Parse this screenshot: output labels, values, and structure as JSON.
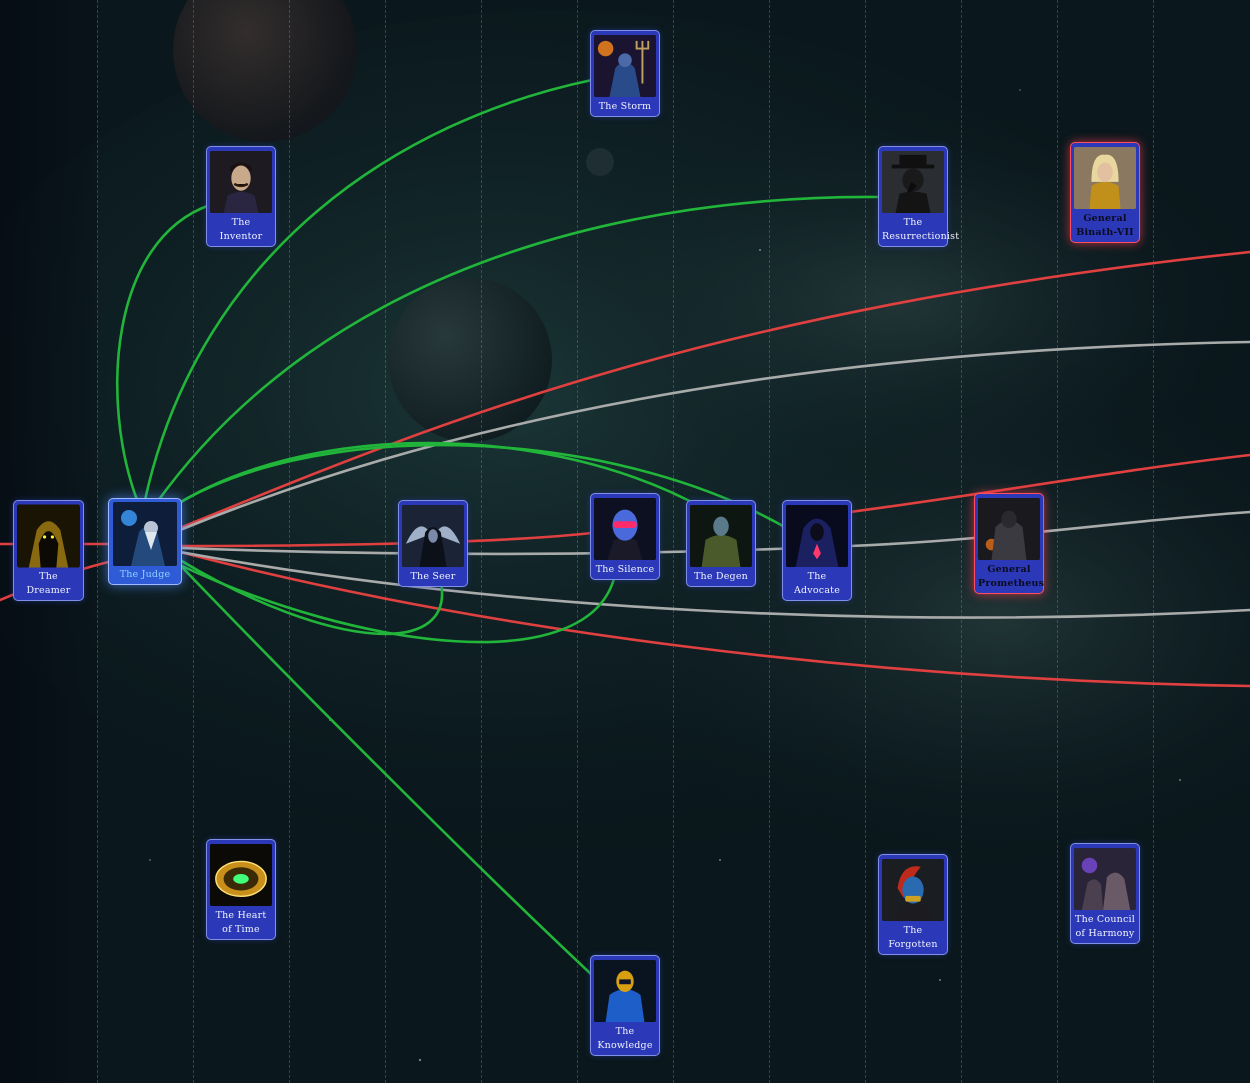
{
  "colors": {
    "background": "#0b1a1f",
    "node_fill": "#2b39b8",
    "node_border": "#7f90e6",
    "general_border": "#ff4f5e",
    "active_label": "#8fd4ff",
    "link_green": "#21b53a",
    "link_red": "#e0403f",
    "link_gray": "#a9abab"
  },
  "nodes": [
    {
      "id": "dreamer",
      "label": "The Dreamer",
      "icon": "hooded-figure-portrait",
      "kind": "normal"
    },
    {
      "id": "judge",
      "label": "The Judge",
      "icon": "wizard-portrait",
      "kind": "active"
    },
    {
      "id": "inventor",
      "label": "The Inventor",
      "icon": "mustached-man-portrait",
      "kind": "normal"
    },
    {
      "id": "heart",
      "label": "The Heart of Time",
      "icon": "clock-wheel-portrait",
      "kind": "normal"
    },
    {
      "id": "seer",
      "label": "The Seer",
      "icon": "winged-seer-portrait",
      "kind": "normal"
    },
    {
      "id": "storm",
      "label": "The Storm",
      "icon": "trident-warrior-portrait",
      "kind": "normal"
    },
    {
      "id": "silence",
      "label": "The Silence",
      "icon": "masked-alien-portrait",
      "kind": "normal"
    },
    {
      "id": "knowledge",
      "label": "The Knowledge",
      "icon": "blue-armored-portrait",
      "kind": "normal"
    },
    {
      "id": "degen",
      "label": "The Degen",
      "icon": "green-soldier-portrait",
      "kind": "normal"
    },
    {
      "id": "advocate",
      "label": "The Advocate",
      "icon": "hooded-mage-portrait",
      "kind": "normal"
    },
    {
      "id": "resurrectionist",
      "label": "The Resurrectionist",
      "icon": "plague-doctor-portrait",
      "kind": "normal"
    },
    {
      "id": "forgotten",
      "label": "The Forgotten",
      "icon": "red-haired-masked-portrait",
      "kind": "normal"
    },
    {
      "id": "prometheus",
      "label": "General Prometheus",
      "icon": "dark-knight-portrait",
      "kind": "general"
    },
    {
      "id": "binath",
      "label": "General Binath-VII",
      "icon": "blonde-warrior-portrait",
      "kind": "general"
    },
    {
      "id": "council",
      "label": "The Council of Harmony",
      "icon": "council-figures-portrait",
      "kind": "normal"
    }
  ],
  "links": [
    {
      "color": "green",
      "from": "judge",
      "to": "inventor"
    },
    {
      "color": "green",
      "from": "judge",
      "to": "storm"
    },
    {
      "color": "green",
      "from": "judge",
      "to": "resurrectionist"
    },
    {
      "color": "green",
      "from": "judge",
      "to": "degen"
    },
    {
      "color": "green",
      "from": "judge",
      "to": "advocate"
    },
    {
      "color": "green",
      "from": "judge",
      "to": "seer"
    },
    {
      "color": "green",
      "from": "judge",
      "to": "silence"
    },
    {
      "color": "green",
      "from": "judge",
      "to": "knowledge"
    },
    {
      "color": "red",
      "from": "dreamer",
      "to": "judge"
    },
    {
      "color": "red",
      "from": "judge",
      "to": "prometheus"
    },
    {
      "color": "red",
      "from": "judge",
      "to": "offscreen-top"
    },
    {
      "color": "red",
      "from": "judge",
      "to": "offscreen-bottom"
    },
    {
      "color": "red",
      "from": "offscreen-left",
      "to": "offscreen-right"
    },
    {
      "color": "gray",
      "from": "judge",
      "to": "advocate"
    },
    {
      "color": "gray",
      "from": "judge",
      "to": "offscreen-upper"
    },
    {
      "color": "gray",
      "from": "judge",
      "to": "offscreen-lower"
    },
    {
      "color": "gray",
      "from": "advocate",
      "to": "offscreen-right"
    }
  ]
}
